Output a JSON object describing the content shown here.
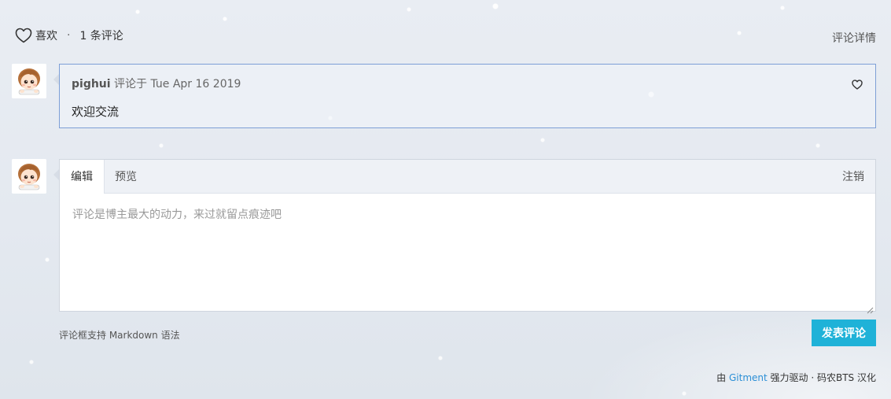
{
  "header": {
    "like_label": "喜欢",
    "separator": "·",
    "comment_count": "1 条评论",
    "issue_link": "评论详情"
  },
  "comments": [
    {
      "author": "pighui",
      "date_prefix": "评论于",
      "date": "Tue Apr 16 2019",
      "body": "欢迎交流"
    }
  ],
  "editor": {
    "tab_edit": "编辑",
    "tab_preview": "预览",
    "logout": "注销",
    "placeholder": "评论是博主最大的动力，来过就留点痕迹吧",
    "value": ""
  },
  "footer": {
    "tip": "评论框支持 Markdown 语法",
    "submit": "发表评论",
    "powered_prefix": "由",
    "powered_link": "Gitment",
    "powered_suffix": "强力驱动 · 码农BTS 汉化"
  },
  "colors": {
    "accent": "#1fb2d8",
    "link": "#2b8fd6",
    "comment_border": "#7d9fd6"
  },
  "icons": {
    "like": "heart-outline-icon",
    "comment_like": "heart-outline-icon",
    "avatar": "cartoon-avatar-icon"
  }
}
